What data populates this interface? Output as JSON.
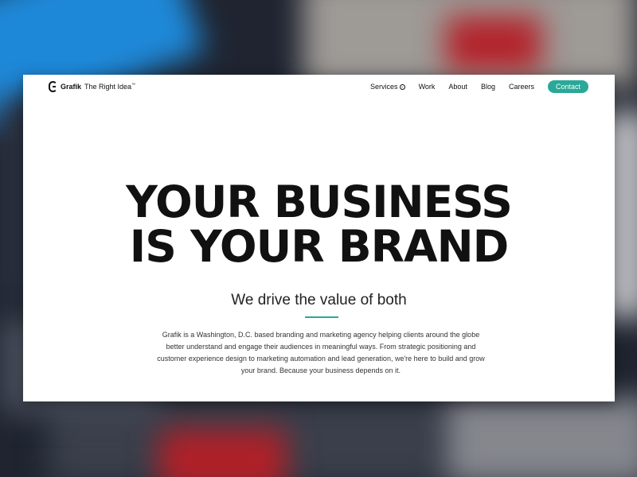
{
  "header": {
    "brand": "Grafik",
    "tagline": "The Right Idea",
    "trademark": "™",
    "nav": [
      {
        "label": "Services"
      },
      {
        "label": "Work"
      },
      {
        "label": "About"
      },
      {
        "label": "Blog"
      },
      {
        "label": "Careers"
      }
    ],
    "contact_label": "Contact"
  },
  "hero": {
    "headline_line1": "YOUR BUSINESS",
    "headline_line2": "IS YOUR BRAND",
    "subheadline": "We drive the value of both",
    "body": "Grafik is a Washington, D.C. based branding and marketing agency helping clients around the globe better understand and engage their audiences in meaningful ways. From strategic positioning and customer experience design to marketing automation and lead generation, we're here to build and grow your brand. Because your business depends on it."
  },
  "colors": {
    "accent": "#2aa898",
    "text": "#111111",
    "background": "#ffffff"
  },
  "icons": {
    "services_dropdown": "chevron-down-icon",
    "logo": "grafik-logo-icon"
  }
}
